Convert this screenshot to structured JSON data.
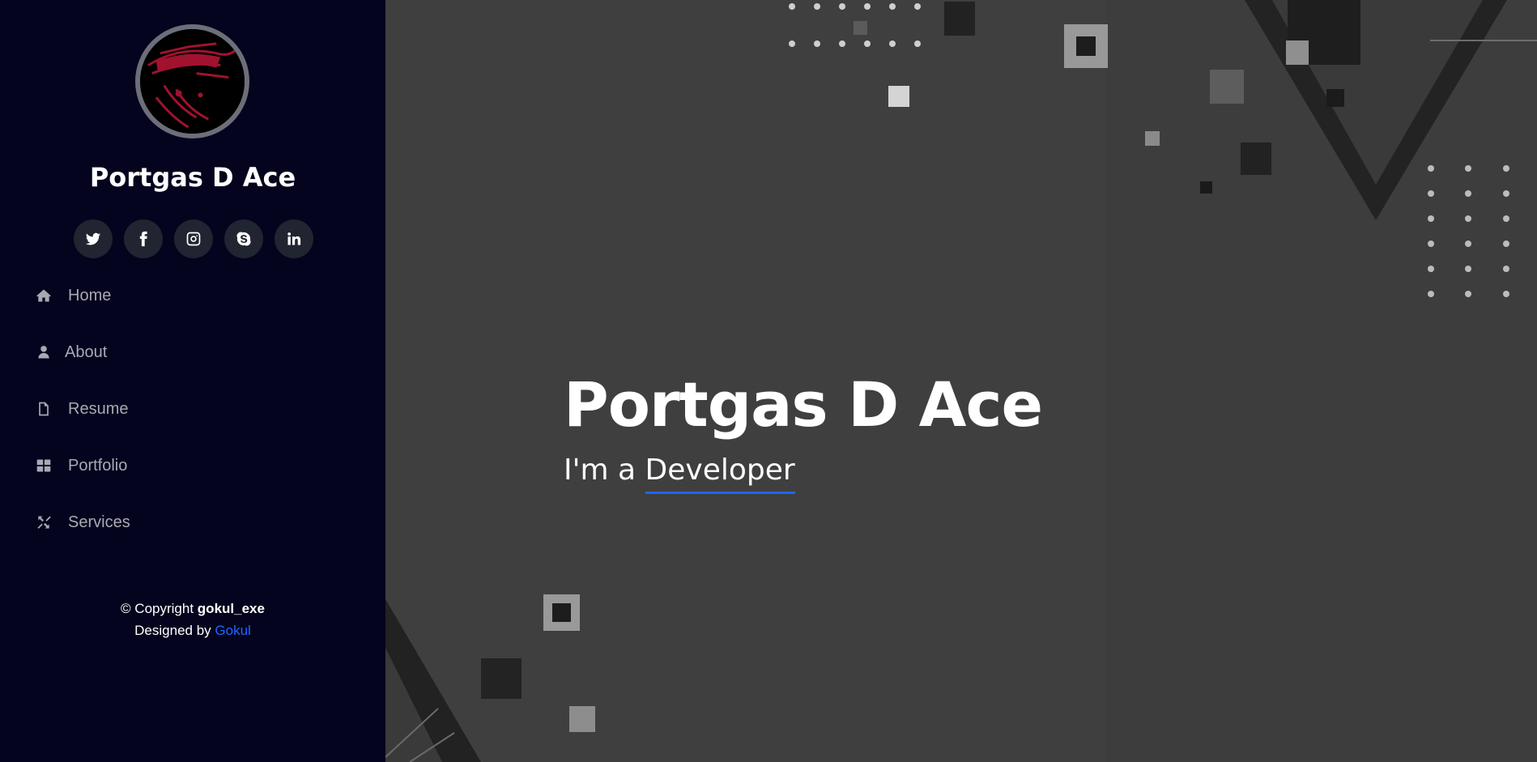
{
  "profile": {
    "name": "Portgas D Ace"
  },
  "social": [
    {
      "icon": "twitter-icon",
      "name": "social-twitter"
    },
    {
      "icon": "facebook-icon",
      "name": "social-facebook"
    },
    {
      "icon": "instagram-icon",
      "name": "social-instagram"
    },
    {
      "icon": "skype-icon",
      "name": "social-skype"
    },
    {
      "icon": "linkedin-icon",
      "name": "social-linkedin"
    }
  ],
  "nav": {
    "items": [
      {
        "label": "Home",
        "icon": "home-icon"
      },
      {
        "label": "About",
        "icon": "user-icon"
      },
      {
        "label": "Resume",
        "icon": "file-icon"
      },
      {
        "label": "Portfolio",
        "icon": "grid-icon"
      },
      {
        "label": "Services",
        "icon": "services-icon"
      }
    ]
  },
  "footer": {
    "copyright_prefix": "© Copyright",
    "copyright_name": "gokul_exe",
    "designed_prefix": "Designed by",
    "designer": "Gokul"
  },
  "hero": {
    "title": "Portgas D Ace",
    "subtitle_prefix": "I'm a",
    "typed_word": "Developer"
  },
  "colors": {
    "sidebar_bg": "#05041e",
    "accent": "#1f66ff",
    "hero_bg": "#3e3d3d"
  }
}
